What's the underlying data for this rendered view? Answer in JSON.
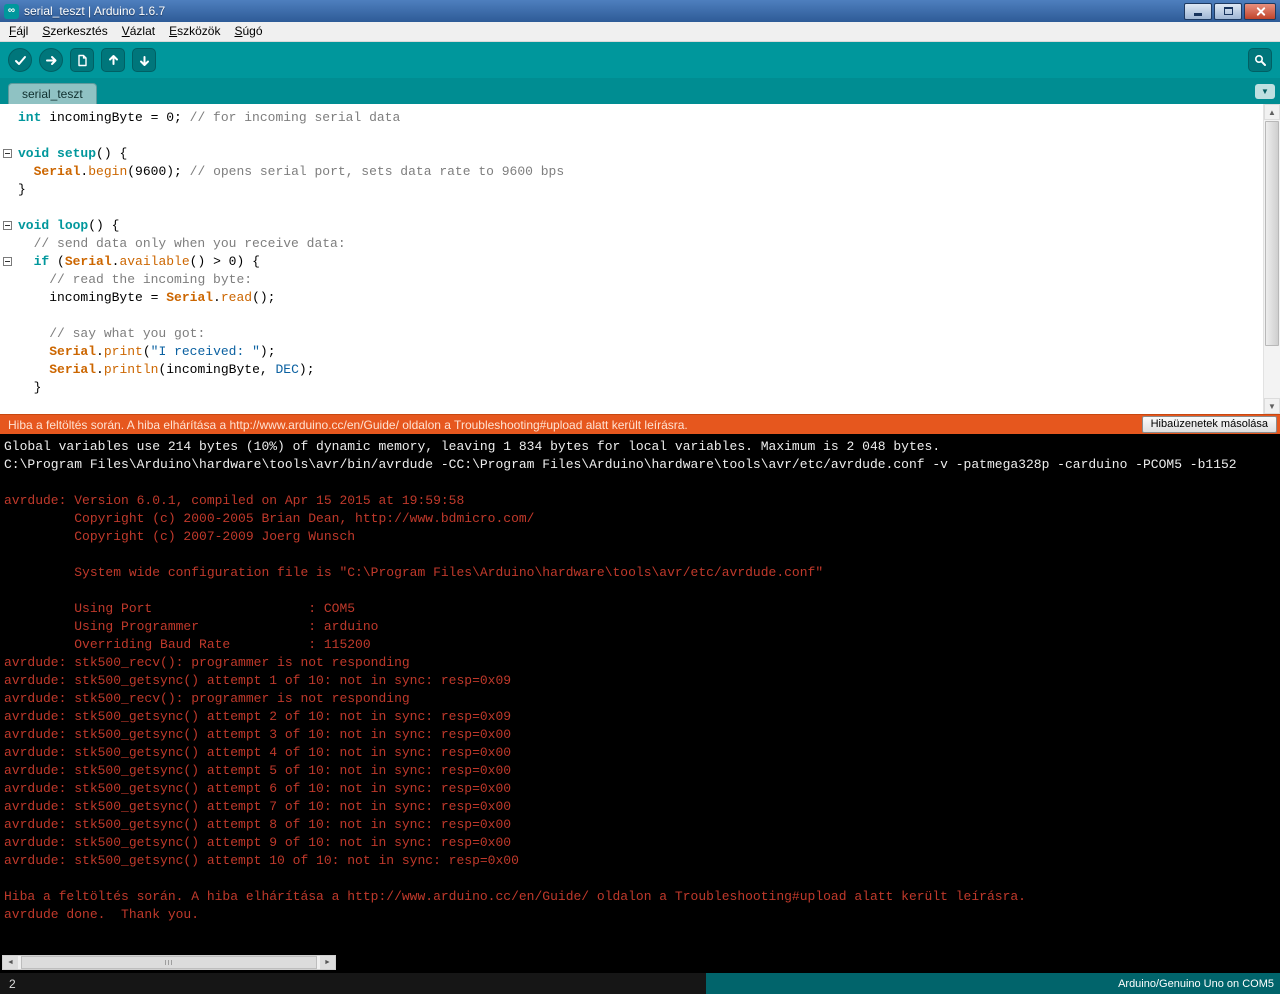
{
  "window": {
    "title": "serial_teszt | Arduino 1.6.7"
  },
  "icons": {
    "app": "∞",
    "chevron_down": "▼",
    "scroll_up": "▲",
    "scroll_down": "▼",
    "scroll_left": "◄",
    "scroll_right": "►"
  },
  "menu": {
    "items": [
      "Fájl",
      "Szerkesztés",
      "Vázlat",
      "Eszközök",
      "Súgó"
    ]
  },
  "toolbar": {
    "buttons": [
      {
        "name": "verify",
        "icon": "check-icon"
      },
      {
        "name": "upload",
        "icon": "upload-arrow-icon"
      },
      {
        "name": "new-sketch",
        "icon": "new-document-icon"
      },
      {
        "name": "open",
        "icon": "open-arrow-icon"
      },
      {
        "name": "save",
        "icon": "save-arrow-icon"
      },
      {
        "name": "serial-monitor",
        "icon": "magnifier-icon"
      }
    ]
  },
  "tabs": {
    "active_label": "serial_teszt"
  },
  "colors": {
    "teal": "#00979C",
    "error_orange": "#E6571E",
    "console_error_red": "#C0392B",
    "console_bg": "#000000"
  },
  "editor": {
    "lines": [
      {
        "fold": false,
        "tokens": [
          [
            "kw",
            "int"
          ],
          [
            "pl",
            " incomingByte = 0; "
          ],
          [
            "cm",
            "// for incoming serial data"
          ]
        ]
      },
      {
        "fold": false,
        "tokens": []
      },
      {
        "fold": true,
        "tokens": [
          [
            "kw",
            "void"
          ],
          [
            "pl",
            " "
          ],
          [
            "kw",
            "setup"
          ],
          [
            "pl",
            "() {"
          ]
        ]
      },
      {
        "fold": false,
        "tokens": [
          [
            "pl",
            "  "
          ],
          [
            "cls",
            "Serial"
          ],
          [
            "pl",
            "."
          ],
          [
            "fn",
            "begin"
          ],
          [
            "pl",
            "(9600); "
          ],
          [
            "cm",
            "// opens serial port, sets data rate to 9600 bps"
          ]
        ]
      },
      {
        "fold": false,
        "tokens": [
          [
            "pl",
            "}"
          ]
        ]
      },
      {
        "fold": false,
        "tokens": []
      },
      {
        "fold": true,
        "tokens": [
          [
            "kw",
            "void"
          ],
          [
            "pl",
            " "
          ],
          [
            "kw",
            "loop"
          ],
          [
            "pl",
            "() {"
          ]
        ]
      },
      {
        "fold": false,
        "tokens": [
          [
            "pl",
            "  "
          ],
          [
            "cm",
            "// send data only when you receive data:"
          ]
        ]
      },
      {
        "fold": true,
        "tokens": [
          [
            "pl",
            "  "
          ],
          [
            "kw",
            "if"
          ],
          [
            "pl",
            " ("
          ],
          [
            "cls",
            "Serial"
          ],
          [
            "pl",
            "."
          ],
          [
            "fn",
            "available"
          ],
          [
            "pl",
            "() > 0) {"
          ]
        ]
      },
      {
        "fold": false,
        "tokens": [
          [
            "pl",
            "    "
          ],
          [
            "cm",
            "// read the incoming byte:"
          ]
        ]
      },
      {
        "fold": false,
        "tokens": [
          [
            "pl",
            "    incomingByte = "
          ],
          [
            "cls",
            "Serial"
          ],
          [
            "pl",
            "."
          ],
          [
            "fn",
            "read"
          ],
          [
            "pl",
            "();"
          ]
        ]
      },
      {
        "fold": false,
        "tokens": []
      },
      {
        "fold": false,
        "tokens": [
          [
            "pl",
            "    "
          ],
          [
            "cm",
            "// say what you got:"
          ]
        ]
      },
      {
        "fold": false,
        "tokens": [
          [
            "pl",
            "    "
          ],
          [
            "cls",
            "Serial"
          ],
          [
            "pl",
            "."
          ],
          [
            "fn",
            "print"
          ],
          [
            "pl",
            "("
          ],
          [
            "str",
            "\"I received: \""
          ],
          [
            "pl",
            ");"
          ]
        ]
      },
      {
        "fold": false,
        "tokens": [
          [
            "pl",
            "    "
          ],
          [
            "cls",
            "Serial"
          ],
          [
            "pl",
            "."
          ],
          [
            "fn",
            "println"
          ],
          [
            "pl",
            "(incomingByte, "
          ],
          [
            "const",
            "DEC"
          ],
          [
            "pl",
            ");"
          ]
        ]
      },
      {
        "fold": false,
        "tokens": [
          [
            "pl",
            "  }"
          ]
        ]
      }
    ]
  },
  "error_banner": {
    "message": "Hiba a feltöltés során. A hiba elhárítása a http://www.arduino.cc/en/Guide/ oldalon a Troubleshooting#upload alatt került leírásra.",
    "button_label": "Hibaüzenetek másolása"
  },
  "console": {
    "lines": [
      {
        "c": "out",
        "t": "Global variables use 214 bytes (10%) of dynamic memory, leaving 1 834 bytes for local variables. Maximum is 2 048 bytes."
      },
      {
        "c": "out",
        "t": "C:\\Program Files\\Arduino\\hardware\\tools\\avr/bin/avrdude -CC:\\Program Files\\Arduino\\hardware\\tools\\avr/etc/avrdude.conf -v -patmega328p -carduino -PCOM5 -b1152"
      },
      {
        "c": "out",
        "t": ""
      },
      {
        "c": "err",
        "t": "avrdude: Version 6.0.1, compiled on Apr 15 2015 at 19:59:58"
      },
      {
        "c": "err",
        "t": "         Copyright (c) 2000-2005 Brian Dean, http://www.bdmicro.com/"
      },
      {
        "c": "err",
        "t": "         Copyright (c) 2007-2009 Joerg Wunsch"
      },
      {
        "c": "err",
        "t": ""
      },
      {
        "c": "err",
        "t": "         System wide configuration file is \"C:\\Program Files\\Arduino\\hardware\\tools\\avr/etc/avrdude.conf\""
      },
      {
        "c": "err",
        "t": ""
      },
      {
        "c": "err",
        "t": "         Using Port                    : COM5"
      },
      {
        "c": "err",
        "t": "         Using Programmer              : arduino"
      },
      {
        "c": "err",
        "t": "         Overriding Baud Rate          : 115200"
      },
      {
        "c": "err",
        "t": "avrdude: stk500_recv(): programmer is not responding"
      },
      {
        "c": "err",
        "t": "avrdude: stk500_getsync() attempt 1 of 10: not in sync: resp=0x09"
      },
      {
        "c": "err",
        "t": "avrdude: stk500_recv(): programmer is not responding"
      },
      {
        "c": "err",
        "t": "avrdude: stk500_getsync() attempt 2 of 10: not in sync: resp=0x09"
      },
      {
        "c": "err",
        "t": "avrdude: stk500_getsync() attempt 3 of 10: not in sync: resp=0x00"
      },
      {
        "c": "err",
        "t": "avrdude: stk500_getsync() attempt 4 of 10: not in sync: resp=0x00"
      },
      {
        "c": "err",
        "t": "avrdude: stk500_getsync() attempt 5 of 10: not in sync: resp=0x00"
      },
      {
        "c": "err",
        "t": "avrdude: stk500_getsync() attempt 6 of 10: not in sync: resp=0x00"
      },
      {
        "c": "err",
        "t": "avrdude: stk500_getsync() attempt 7 of 10: not in sync: resp=0x00"
      },
      {
        "c": "err",
        "t": "avrdude: stk500_getsync() attempt 8 of 10: not in sync: resp=0x00"
      },
      {
        "c": "err",
        "t": "avrdude: stk500_getsync() attempt 9 of 10: not in sync: resp=0x00"
      },
      {
        "c": "err",
        "t": "avrdude: stk500_getsync() attempt 10 of 10: not in sync: resp=0x00"
      },
      {
        "c": "err",
        "t": ""
      },
      {
        "c": "err",
        "t": "Hiba a feltöltés során. A hiba elhárítása a http://www.arduino.cc/en/Guide/ oldalon a Troubleshooting#upload alatt került leírásra."
      },
      {
        "c": "err",
        "t": "avrdude done.  Thank you."
      }
    ]
  },
  "statusbar": {
    "line_number": "2",
    "board_info": "Arduino/Genuino Uno on COM5"
  }
}
